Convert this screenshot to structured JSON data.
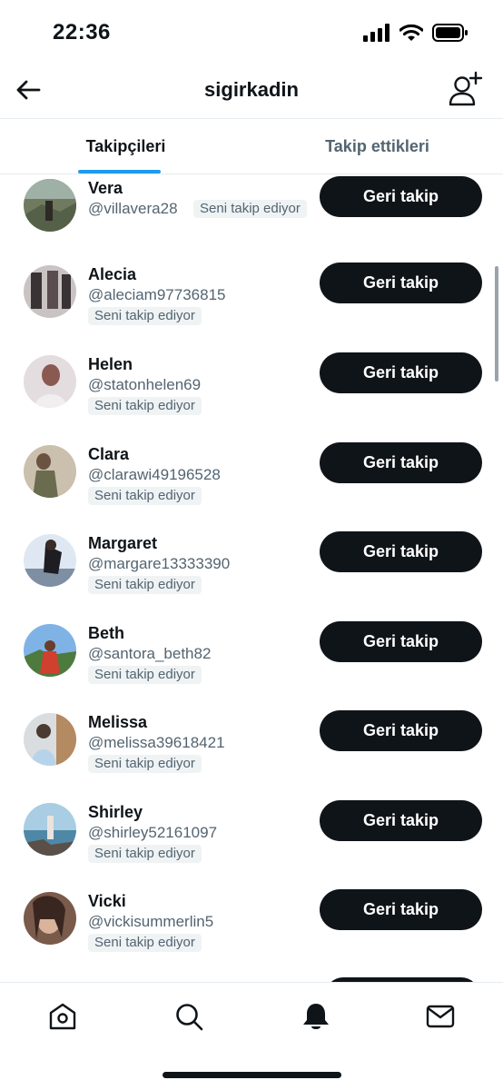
{
  "status_bar": {
    "time": "22:36"
  },
  "header": {
    "title": "sigirkadin"
  },
  "tabs": [
    {
      "label": "Takipçileri",
      "active": true
    },
    {
      "label": "Takip ettikleri",
      "active": false
    }
  ],
  "followers": [
    {
      "name": "Vera",
      "handle": "@villavera28",
      "badge": "Seni takip ediyor",
      "button": "Geri takip",
      "avatar_color": "#6f7a5e"
    },
    {
      "name": "Alecia",
      "handle": "@aleciam97736815",
      "badge": "Seni takip ediyor",
      "button": "Geri takip",
      "avatar_color": "#8a7c80"
    },
    {
      "name": "Helen",
      "handle": "@statonhelen69",
      "badge": "Seni takip ediyor",
      "button": "Geri takip",
      "avatar_color": "#c9bcc0"
    },
    {
      "name": "Clara",
      "handle": "@clarawi49196528",
      "badge": "Seni takip ediyor",
      "button": "Geri takip",
      "avatar_color": "#8b7a68"
    },
    {
      "name": "Margaret",
      "handle": "@margare13333390",
      "badge": "Seni takip ediyor",
      "button": "Geri takip",
      "avatar_color": "#7e8fa4"
    },
    {
      "name": "Beth",
      "handle": "@santora_beth82",
      "badge": "Seni takip ediyor",
      "button": "Geri takip",
      "avatar_color": "#5d8fc2"
    },
    {
      "name": "Melissa",
      "handle": "@melissa39618421",
      "badge": "Seni takip ediyor",
      "button": "Geri takip",
      "avatar_color": "#b7c0c7"
    },
    {
      "name": "Shirley",
      "handle": "@shirley52161097",
      "badge": "Seni takip ediyor",
      "button": "Geri takip",
      "avatar_color": "#6e93a8"
    },
    {
      "name": "Vicki",
      "handle": "@vickisummerlin5",
      "badge": "Seni takip ediyor",
      "button": "Geri takip",
      "avatar_color": "#6b4a3c"
    }
  ],
  "bottom_nav": [
    {
      "icon": "home-icon"
    },
    {
      "icon": "search-icon"
    },
    {
      "icon": "bell-icon",
      "active": true
    },
    {
      "icon": "mail-icon"
    }
  ],
  "colors": {
    "accent": "#1d9bf0",
    "button": "#0f1419",
    "secondary_text": "#536471"
  }
}
